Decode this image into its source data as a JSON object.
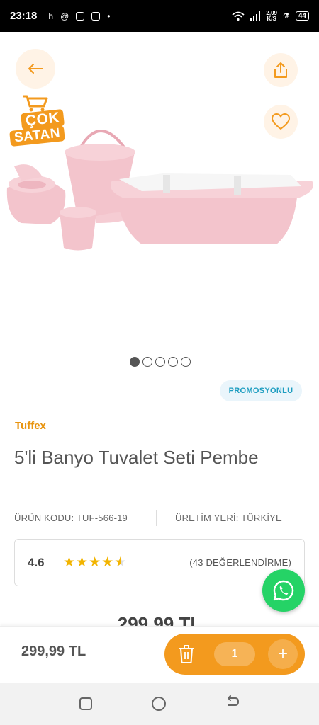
{
  "status_bar": {
    "time": "23:18",
    "left_icons": [
      "h",
      "threads-icon",
      "instagram-icon",
      "instagram-icon",
      "dot-icon"
    ],
    "net_speed_value": "2,09",
    "net_speed_unit": "K/S",
    "battery": "44"
  },
  "hero": {
    "badge_line1": "ÇOK",
    "badge_line2": "SATAN",
    "image_count": 5,
    "active_image_index": 0
  },
  "product": {
    "promo_label": "PROMOSYONLU",
    "brand": "Tuffex",
    "title": "5'li Banyo Tuvalet Seti Pembe",
    "code": "ÜRÜN KODU: TUF-566-19",
    "origin": "ÜRETİM YERİ: TÜRKİYE",
    "rating": "4.6",
    "rating_stars": 4.5,
    "rating_count": "(43 DEĞERLENDİRME)",
    "price_peek": "299,99 TL"
  },
  "bottom_bar": {
    "price": "299,99 TL",
    "quantity": "1",
    "plus_label": "+"
  },
  "colors": {
    "accent": "#f39a1e",
    "promo_text": "#1d9dc0",
    "whatsapp": "#25d366",
    "star": "#f2b400"
  }
}
